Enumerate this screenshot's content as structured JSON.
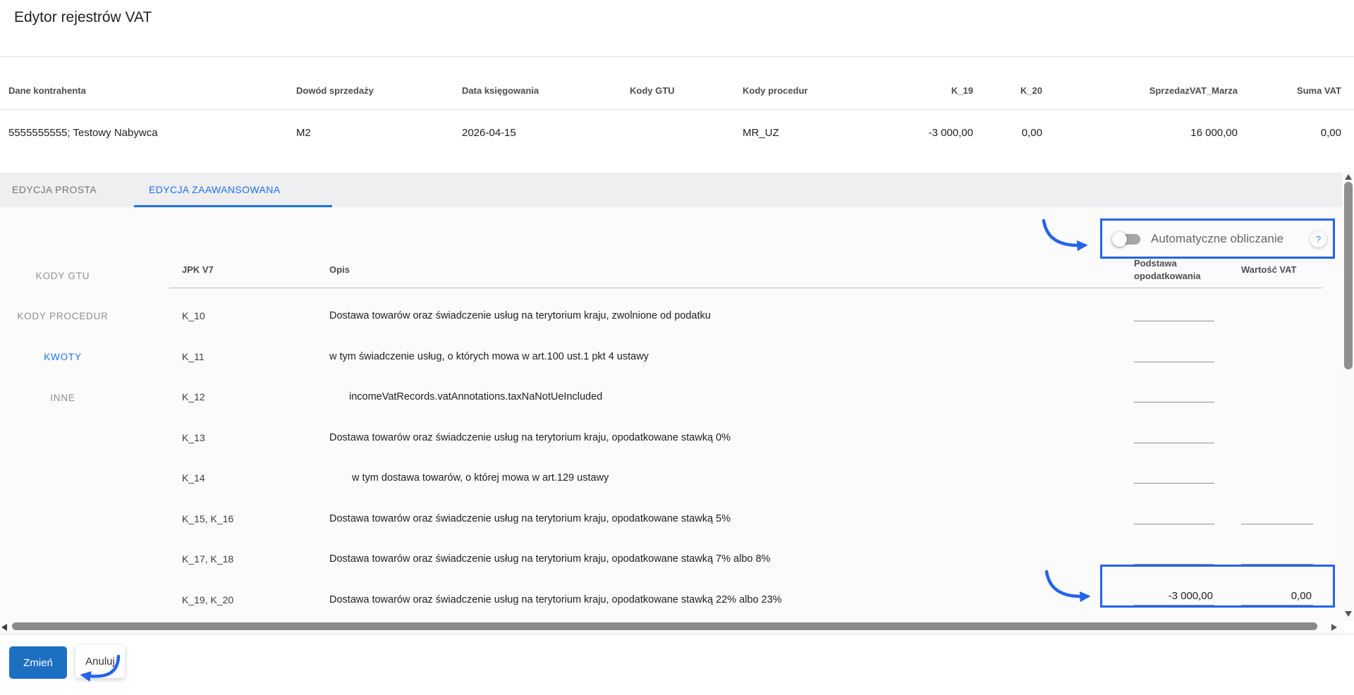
{
  "page": {
    "title": "Edytor rejestrów VAT"
  },
  "record": {
    "headers": [
      "Dane kontrahenta",
      "Dowód sprzedaży",
      "Data księgowania",
      "Kody GTU",
      "Kody procedur",
      "K_19",
      "K_20",
      "SprzedazVAT_Marza",
      "Suma VAT"
    ],
    "values": [
      "5555555555; Testowy Nabywca",
      "M2",
      "2026-04-15",
      "",
      "MR_UZ",
      "-3 000,00",
      "0,00",
      "16 000,00",
      "0,00"
    ]
  },
  "tabs": {
    "simple": "EDYCJA PROSTA",
    "advanced": "EDYCJA ZAAWANSOWANA",
    "active": "EDYCJA ZAAWANSOWANA"
  },
  "auto_calc": {
    "label": "Automatyczne obliczanie",
    "help": "?",
    "state": "off"
  },
  "sidebar": {
    "items": [
      {
        "label": "KODY GTU",
        "active": false
      },
      {
        "label": "KODY PROCEDUR",
        "active": false
      },
      {
        "label": "KWOTY",
        "active": true
      },
      {
        "label": "INNE",
        "active": false
      }
    ]
  },
  "amounts": {
    "headers": {
      "code": "JPK V7",
      "desc": "Opis",
      "base_line1": "Podstawa",
      "base_line2": "opodatkowania",
      "vat": "Wartość VAT"
    },
    "rows": [
      {
        "code": "K_10",
        "desc": "Dostawa towarów oraz świadczenie usług na terytorium kraju, zwolnione od podatku",
        "base": ""
      },
      {
        "code": "K_11",
        "desc": "w tym świadczenie usług, o których mowa w art.100 ust.1 pkt 4 ustawy",
        "base": ""
      },
      {
        "code": "K_12",
        "desc": "incomeVatRecords.vatAnnotations.taxNaNotUeIncluded",
        "base": ""
      },
      {
        "code": "K_13",
        "desc": "Dostawa towarów oraz świadczenie usług na terytorium kraju, opodatkowane stawką 0%",
        "base": ""
      },
      {
        "code": "K_14",
        "desc": "w tym dostawa towarów, o której mowa w art.129 ustawy",
        "base": ""
      },
      {
        "code": "K_15, K_16",
        "desc": "Dostawa towarów oraz świadczenie usług na terytorium kraju, opodatkowane stawką 5%",
        "base": "",
        "vat": ""
      },
      {
        "code": "K_17, K_18",
        "desc": "Dostawa towarów oraz świadczenie usług na terytorium kraju, opodatkowane stawką 7% albo 8%",
        "base": "",
        "vat": ""
      },
      {
        "code": "K_19, K_20",
        "desc": "Dostawa towarów oraz świadczenie usług na terytorium kraju, opodatkowane stawką 22% albo 23%",
        "base": "-3 000,00",
        "vat": "0,00"
      }
    ]
  },
  "footer": {
    "submit": "Zmień",
    "cancel": "Anuluj"
  },
  "colors": {
    "accent_blue": "#1a73e8",
    "button_blue": "#1d6fc2",
    "annotation_blue": "#2563eb",
    "tabbar_gray": "#efeef0"
  }
}
